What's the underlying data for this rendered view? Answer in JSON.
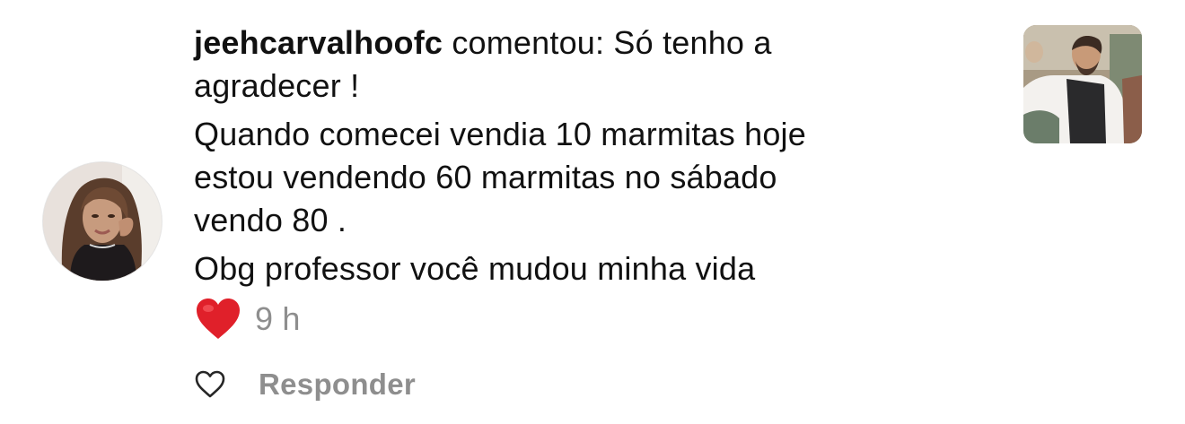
{
  "comment": {
    "username": "jeehcarvalhoofc",
    "action_text": " comentou: Só tenho a",
    "line_2": "agradecer !",
    "line_3": "Quando comecei vendia 10 marmitas hoje",
    "line_4": "estou vendendo 60 marmitas no sábado",
    "line_5": "vendo 80 .",
    "line_6": "Obg professor você mudou minha vida",
    "time": "9 h"
  },
  "actions": {
    "reply_label": "Responder"
  },
  "icons": {
    "avatar": "user-avatar",
    "reaction": "red-heart-emoji",
    "like": "heart-outline-icon",
    "post_thumbnail": "post-thumbnail-image"
  },
  "colors": {
    "text": "#111111",
    "secondary": "#8e8e8e",
    "heart": "#e0202a"
  }
}
